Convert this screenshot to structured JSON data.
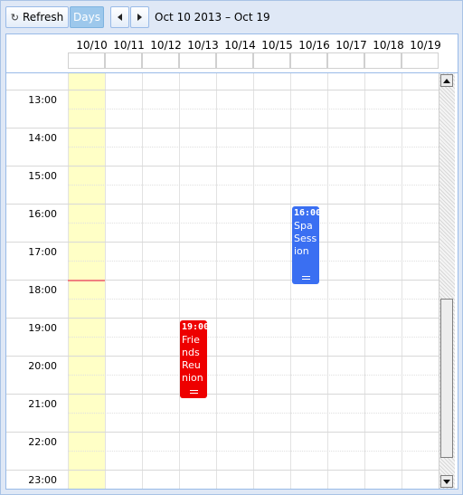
{
  "toolbar": {
    "refresh_label": "Refresh",
    "refresh_icon": "refresh-icon",
    "days_label": "Days",
    "prev_icon": "arrow-left-icon",
    "next_icon": "arrow-right-icon",
    "range_label": "Oct 10 2013 – Oct 19"
  },
  "days": [
    "10/10",
    "10/11",
    "10/12",
    "10/13",
    "10/14",
    "10/15",
    "10/16",
    "10/17",
    "10/18",
    "10/19"
  ],
  "times": [
    "13:00",
    "14:00",
    "15:00",
    "16:00",
    "17:00",
    "18:00",
    "19:00",
    "20:00",
    "21:00",
    "22:00",
    "23:00"
  ],
  "events": {
    "spa": {
      "time": "16:00",
      "title": "Spa Session",
      "color": "#3a6ff2"
    },
    "friends": {
      "time": "19:00",
      "title": "Friends Reunion",
      "color": "#ee0000"
    }
  },
  "colors": {
    "today_highlight": "#ffffc6",
    "now_marker": "#f08080",
    "active_view": "#9dc8ec"
  }
}
